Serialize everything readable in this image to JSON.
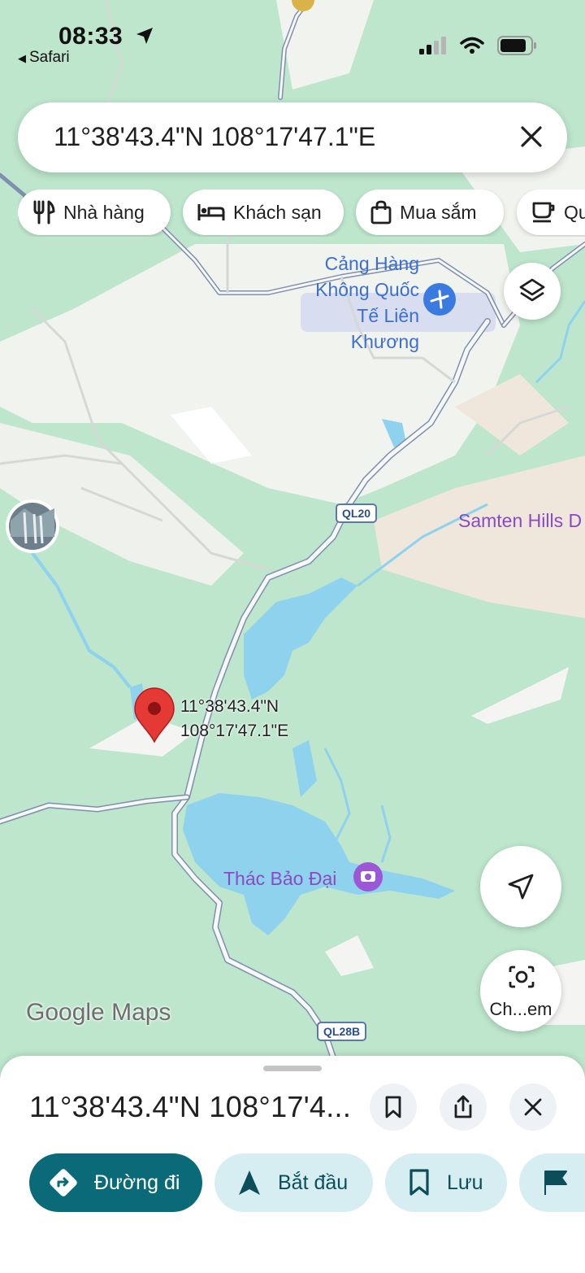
{
  "status_bar": {
    "time": "08:33",
    "back_label": "Safari"
  },
  "search": {
    "query": "11°38'43.4\"N 108°17'47.1\"E"
  },
  "chips": [
    {
      "label": "Nhà hàng",
      "icon": "restaurant-icon"
    },
    {
      "label": "Khách sạn",
      "icon": "hotel-icon"
    },
    {
      "label": "Mua sắm",
      "icon": "shopping-bag-icon"
    },
    {
      "label": "Qu",
      "icon": "coffee-icon"
    }
  ],
  "map": {
    "airport_label": "Cảng Hàng Không Quốc Tế Liên Khương",
    "samten_label": "Samten Hills D",
    "waterfall_label": "Thác Bảo Đại",
    "road_ql20": "QL20",
    "road_ql28b": "QL28B",
    "pin_lat": "11°38'43.4\"N",
    "pin_lng": "108°17'47.1\"E",
    "logo": "Google Maps",
    "lens_label": "Ch...em"
  },
  "sheet": {
    "title": "11°38'43.4\"N 108°17'4...",
    "actions": {
      "directions": "Đường đi",
      "start": "Bắt đầu",
      "save": "Lưu"
    }
  },
  "colors": {
    "map_green": "#bde6cc",
    "road_grey": "#f4f5f3",
    "water_blue": "#8fd2ee",
    "pin_red": "#e53935",
    "primary_teal": "#0b6a78",
    "light_teal": "#d6eef2"
  }
}
